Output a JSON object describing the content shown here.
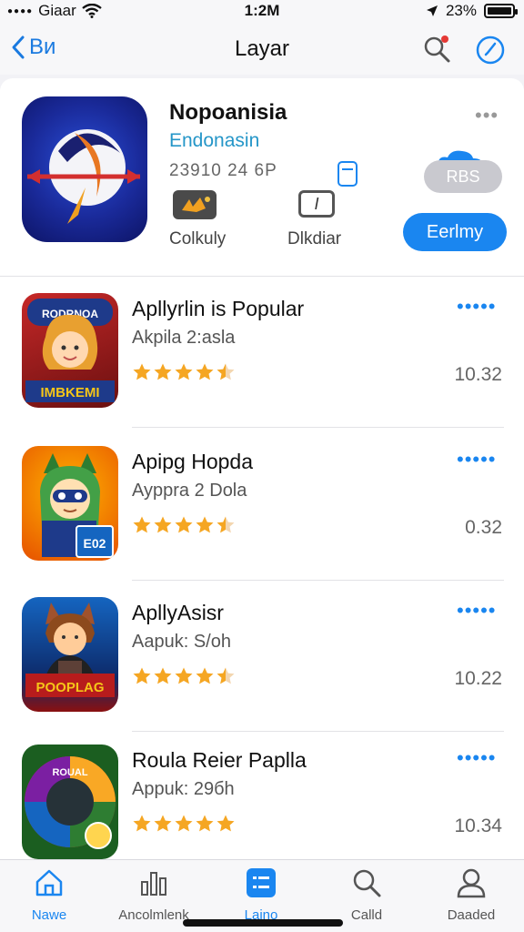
{
  "status": {
    "carrier": "Giaar",
    "time": "1:2M",
    "battery": "23%",
    "battery_level": 0.23
  },
  "nav": {
    "back_label": "Bи",
    "title": "Layar"
  },
  "featured": {
    "title": "Nopoanisia",
    "subtitle": "Endonasin",
    "meta": "23910 24 6P",
    "more": "•••",
    "cloud_button": "RBS",
    "get_button": "Eerlmy",
    "label1": "Colkuly",
    "label2": "Dlkdiar",
    "badge2": "I"
  },
  "apps": [
    {
      "name": "Apllyrlin is Popular",
      "sub": "Akpila 2:asla",
      "rating": 4.5,
      "value": "10.32",
      "more": "•••••",
      "icon_text": "IMBKEMI",
      "icon_top": "RODRNOA"
    },
    {
      "name": "Apipg Hopda",
      "sub": "Aypprа 2 Dola",
      "rating": 4.5,
      "value": "0.32",
      "more": "•••••",
      "icon_text": "E02"
    },
    {
      "name": "ApllyAsisr",
      "sub": "Aapuk: S/oh",
      "rating": 4.5,
      "value": "10.22",
      "more": "•••••",
      "icon_text": "POOPLAG"
    },
    {
      "name": "Roula Reier Paplla",
      "sub": "Appuk: 29бh",
      "rating": 5,
      "value": "10.34",
      "more": "•••••",
      "icon_text": "ROUAL"
    }
  ],
  "tabs": [
    {
      "label": "Nawe",
      "icon": "home-icon",
      "active": false
    },
    {
      "label": "Ancolmlenk",
      "icon": "chart-icon",
      "active": false
    },
    {
      "label": "Laino",
      "icon": "list-icon",
      "active": true
    },
    {
      "label": "Calld",
      "icon": "search-icon",
      "active": false
    },
    {
      "label": "Daaded",
      "icon": "person-icon",
      "active": false
    }
  ],
  "colors": {
    "accent": "#1a86f0",
    "star": "#f5a623",
    "subtitle": "#2596c8"
  }
}
